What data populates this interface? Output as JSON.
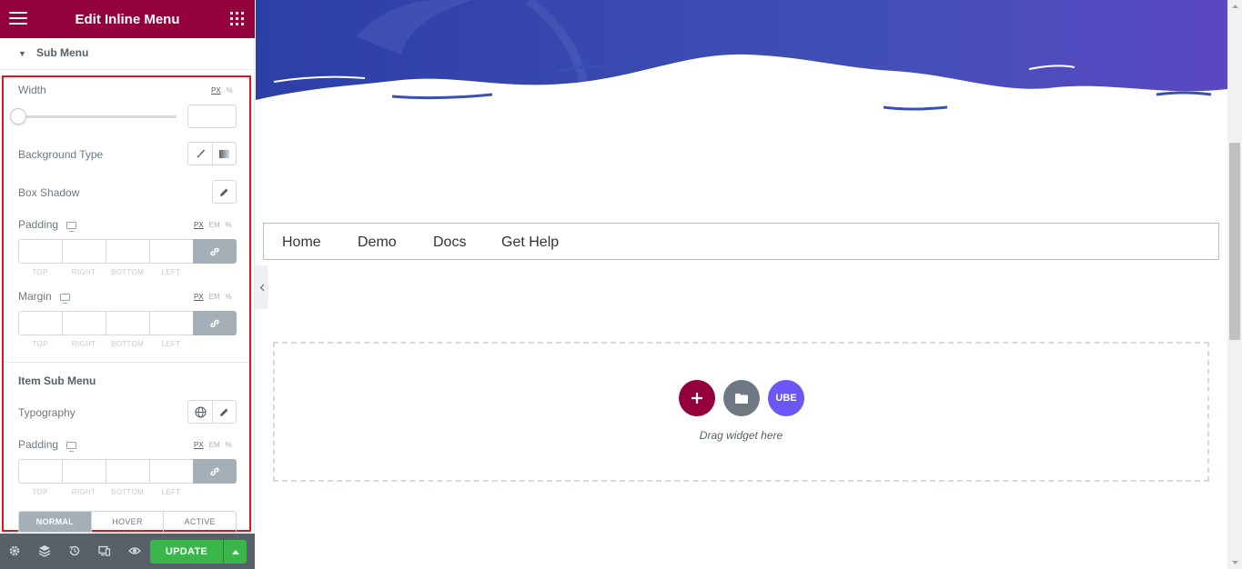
{
  "panel": {
    "title": "Edit Inline Menu",
    "section_title": "Sub Menu",
    "width": {
      "label": "Width",
      "units": [
        "PX",
        "%"
      ],
      "value": ""
    },
    "background_type": {
      "label": "Background Type"
    },
    "box_shadow": {
      "label": "Box Shadow"
    },
    "padding": {
      "label": "Padding",
      "units": [
        "PX",
        "EM",
        "%"
      ],
      "dims": [
        "TOP",
        "RIGHT",
        "BOTTOM",
        "LEFT"
      ]
    },
    "margin": {
      "label": "Margin",
      "units": [
        "PX",
        "EM",
        "%"
      ],
      "dims": [
        "TOP",
        "RIGHT",
        "BOTTOM",
        "LEFT"
      ]
    },
    "item_sub_menu": {
      "heading": "Item Sub Menu",
      "typography_label": "Typography",
      "padding_label": "Padding",
      "units": [
        "PX",
        "EM",
        "%"
      ],
      "dims": [
        "TOP",
        "RIGHT",
        "BOTTOM",
        "LEFT"
      ]
    },
    "state_tabs": [
      "NORMAL",
      "HOVER",
      "ACTIVE"
    ],
    "active_tab": "NORMAL"
  },
  "footer": {
    "update_label": "UPDATE",
    "icons": [
      "settings-icon",
      "layers-icon",
      "history-icon",
      "responsive-icon",
      "preview-eye-icon"
    ]
  },
  "preview": {
    "menu_items": [
      "Home",
      "Demo",
      "Docs",
      "Get Help"
    ],
    "drop_area": {
      "text": "Drag widget here",
      "ube_label": "UBE"
    }
  },
  "colors": {
    "header": "#93003c",
    "accent_red_box": "#e2151c",
    "update_green": "#39b54a",
    "ube_purple": "#6b57f5",
    "wave_blue": "#3a4fb2"
  }
}
